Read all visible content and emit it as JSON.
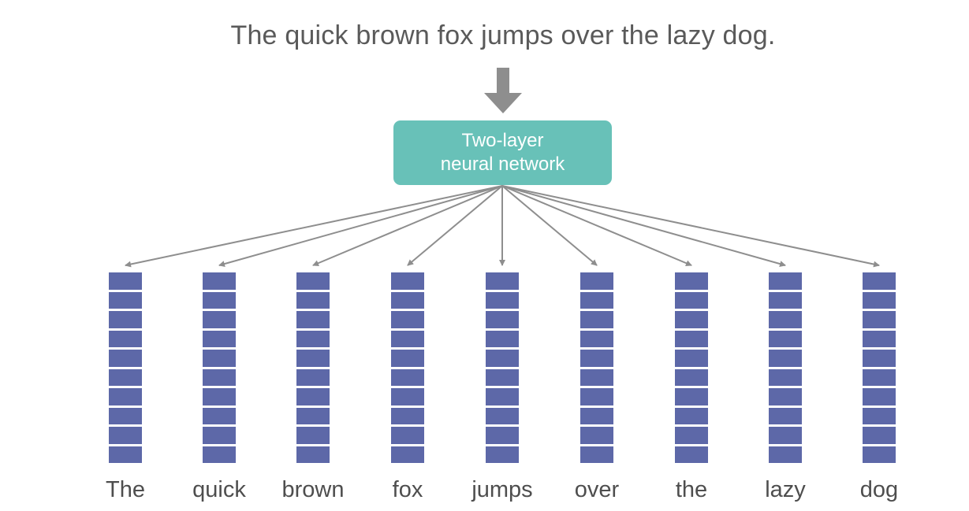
{
  "sentence": "The quick brown fox jumps over the lazy dog.",
  "network": {
    "line1": "Two-layer",
    "line2": "neural network"
  },
  "words": [
    "The",
    "quick",
    "brown",
    "fox",
    "jumps",
    "over",
    "the",
    "lazy",
    "dog"
  ],
  "colors": {
    "network_box": "#68c1b8",
    "vector_cell": "#5d68a8",
    "arrow": "#8e8e8e"
  },
  "icons": {
    "input_arrow": "down-arrow-icon"
  }
}
